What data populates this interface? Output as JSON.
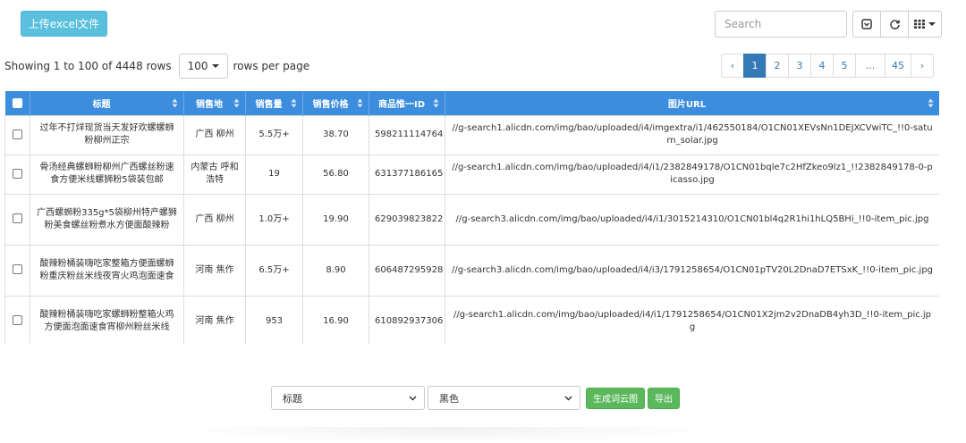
{
  "upload_button": "上传excel文件",
  "search": {
    "placeholder": "Search"
  },
  "toolbar_icons": [
    "toggle-icon",
    "refresh-icon",
    "columns-icon"
  ],
  "info": {
    "showing": "Showing 1 to 100 of 4448 rows",
    "page_size": "100",
    "rows_per_page": "rows per page"
  },
  "pagination": [
    "‹",
    "1",
    "2",
    "3",
    "4",
    "5",
    "...",
    "45",
    "›"
  ],
  "active_page": "1",
  "table": {
    "headers": [
      "标题",
      "销售地",
      "销售量",
      "销售价格",
      "商品惟一ID",
      "图片URL"
    ],
    "rows": [
      [
        "过年不打烊现货当天发好欢螺螺蛳粉柳州正宗",
        "广西 柳州",
        "5.5万+",
        "38.70",
        "598211114764",
        "//g-search1.alicdn.com/img/bao/uploaded/i4/imgextra/i1/462550184/O1CN01XEVsNn1DEJXCVwiTC_!!0-saturn_solar.jpg"
      ],
      [
        "骨汤经典螺蛳粉柳州广西螺丝粉速食方便米线螺狮粉5袋装包邮",
        "内蒙古 呼和浩特",
        "19",
        "56.80",
        "631377186165",
        "//g-search1.alicdn.com/img/bao/uploaded/i4/i1/2382849178/O1CN01bqle7c2HfZkeo9lz1_!!2382849178-0-picasso.jpg"
      ],
      [
        "广西螺蛳粉335g*5袋柳州特产螺狮粉美食螺丝粉煮水方便面酸辣粉",
        "广西 柳州",
        "1.0万+",
        "19.90",
        "629039823822",
        "//g-search3.alicdn.com/img/bao/uploaded/i4/i1/3015214310/O1CN01bl4q2R1hi1hLQ5BHi_!!0-item_pic.jpg"
      ],
      [
        "酸辣粉桶装嗨吃家整箱方便面螺蛳粉重庆粉丝米线夜宵火鸡泡面速食",
        "河南 焦作",
        "6.5万+",
        "8.90",
        "606487295928",
        "//g-search3.alicdn.com/img/bao/uploaded/i4/i3/1791258654/O1CN01pTV20L2DnaD7ETSxK_!!0-item_pic.jpg"
      ],
      [
        "酸辣粉桶装嗨吃家螺蛳粉整箱火鸡方便面泡面速食宵柳州粉丝米线",
        "河南 焦作",
        "953",
        "16.90",
        "610892937306",
        "//g-search1.alicdn.com/img/bao/uploaded/i4/i1/1791258654/O1CN01X2jm2v2DnaDB4yh3D_!!0-item_pic.jpg"
      ]
    ]
  },
  "bottom": {
    "field_select": "标题",
    "color_select": "黑色",
    "wordcloud_button": "生成词云图",
    "export_button": "导出"
  }
}
